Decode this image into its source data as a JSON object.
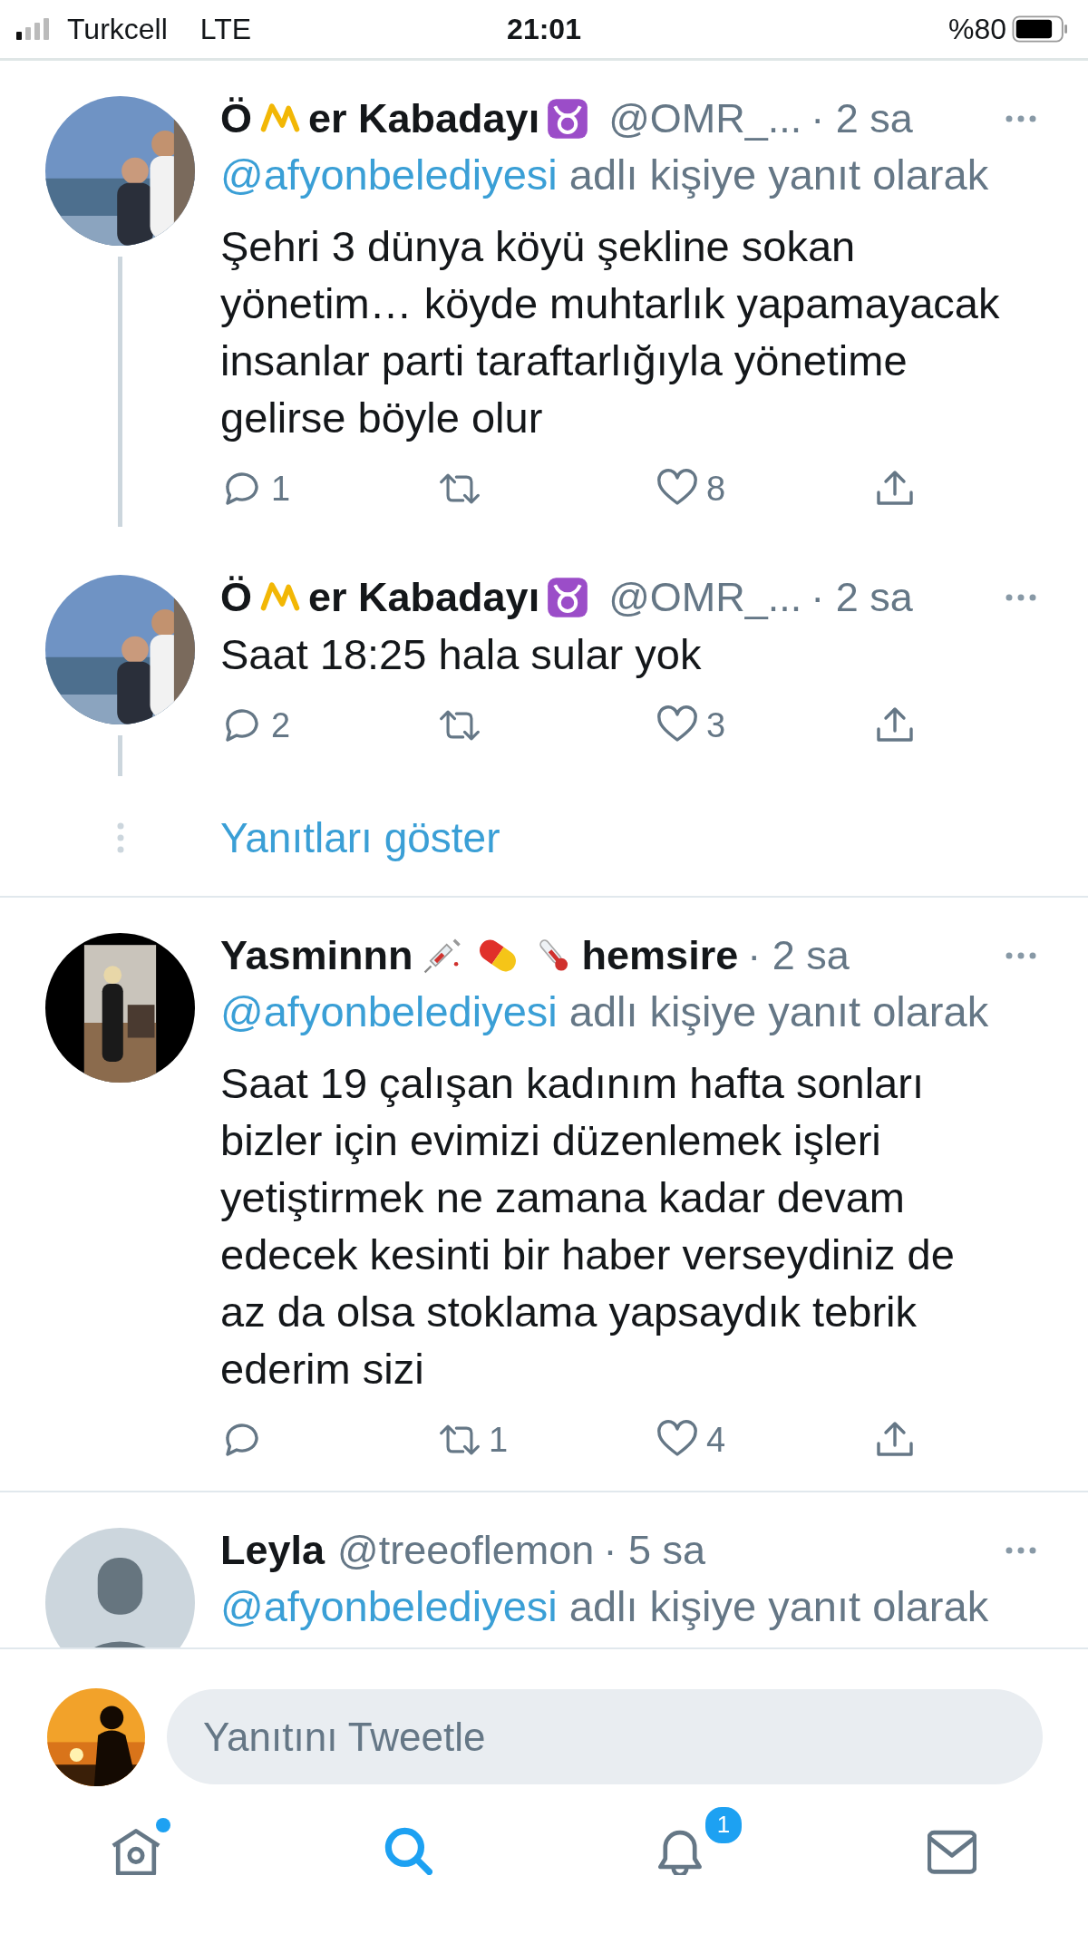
{
  "status_bar": {
    "carrier": "Turkcell",
    "network": "LTE",
    "time": "21:01",
    "battery": "%80"
  },
  "feed": [
    {
      "kind": "thread",
      "tweets": [
        {
          "avatar": {
            "kind": "picture"
          },
          "name": [
            {
              "kind": "text",
              "text": "Ö"
            },
            {
              "kind": "mark"
            },
            {
              "kind": "text",
              "text": "er Kabadayı"
            },
            {
              "kind": "zodiac"
            }
          ],
          "handle": "@OMR_...",
          "time": "· 2 sa",
          "reply_to": {
            "mention": "@afyonbelediyesi",
            "text": "adlı kişiye yanıt olarak"
          },
          "text": "Şehri 3 dünya köyü şekline sokan\nyönetim… köyde muhtarlık yapamayacak\ninsanlar parti taraftarlığıyla yönetime\ngelirse böyle olur",
          "actions": {
            "replies": "1",
            "likes": "8"
          }
        },
        {
          "avatar": {
            "kind": "picture"
          },
          "name": [
            {
              "kind": "text",
              "text": "Ö"
            },
            {
              "kind": "mark"
            },
            {
              "kind": "text",
              "text": "er Kabadayı"
            },
            {
              "kind": "zodiac"
            }
          ],
          "handle": "@OMR_...",
          "time": "· 2 sa",
          "text": "Saat 18:25 hala sular yok",
          "actions": {
            "replies": "2",
            "likes": "3"
          }
        }
      ],
      "show_replies": "Yanıtları göster"
    },
    {
      "kind": "tweet",
      "tweets": [
        {
          "avatar": {
            "kind": "picture"
          },
          "name": [
            {
              "kind": "text",
              "text": "Yasminnn"
            },
            {
              "kind": "syringe"
            },
            {
              "kind": "pill"
            },
            {
              "kind": "thermometer"
            },
            {
              "kind": "text",
              "text": "hemsire"
            }
          ],
          "time": "· 2 sa",
          "reply_to": {
            "mention": "@afyonbelediyesi",
            "text": "adlı kişiye yanıt olarak"
          },
          "text": "Saat 19 çalışan kadınım hafta sonları\nbizler için evimizi düzenlemek işleri\nyetiştirmek ne zamana kadar devam\nedecek kesinti bir haber verseydiniz de\naz da olsa stoklama yapsaydık tebrik\nederim sizi",
          "actions": {
            "retweets": "1",
            "likes": "4"
          }
        }
      ]
    },
    {
      "kind": "tweet",
      "tweets": [
        {
          "avatar": {
            "kind": "default"
          },
          "name": [
            {
              "kind": "text",
              "text": "Leyla"
            }
          ],
          "handle": "@treeoflemon",
          "time": "· 5 sa",
          "reply_to": {
            "mention": "@afyonbelediyesi",
            "text": "adlı kişiye yanıt olarak"
          }
        }
      ]
    }
  ],
  "composer": {
    "placeholder": "Yanıtını Tweetle"
  },
  "tab_bar": [
    {
      "kind": "home",
      "selected": false,
      "dot": true
    },
    {
      "kind": "search",
      "selected": true,
      "dot": false
    },
    {
      "kind": "notifications",
      "selected": false,
      "badge": "1"
    },
    {
      "kind": "messages",
      "selected": false,
      "dot": false
    }
  ]
}
